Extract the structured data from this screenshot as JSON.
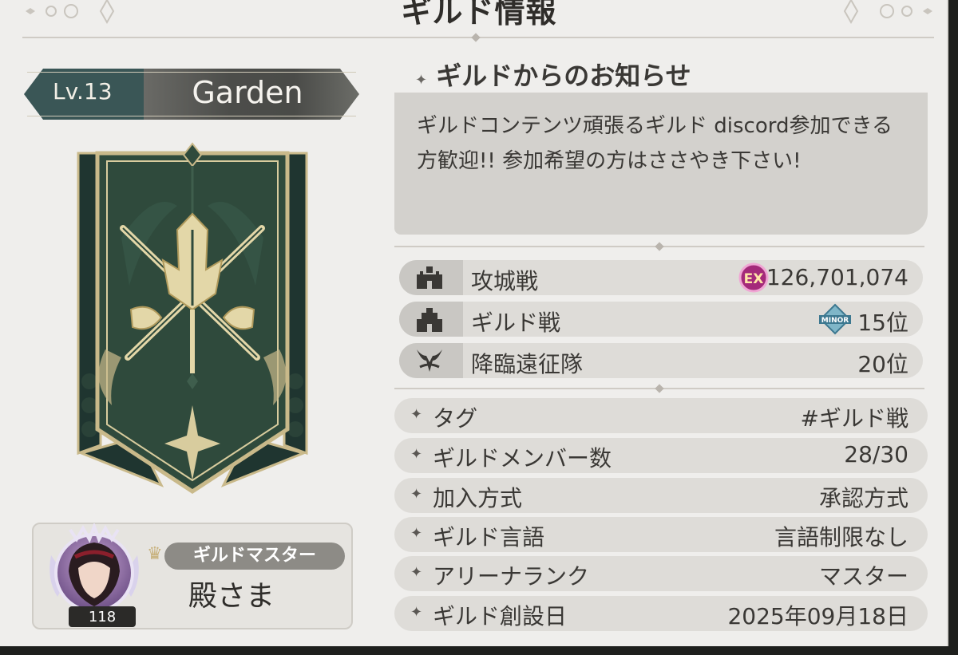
{
  "header": {
    "title": "ギルド情報"
  },
  "guild": {
    "level": "Lv.13",
    "name": "Garden"
  },
  "notice": {
    "heading": "ギルドからのお知らせ",
    "text": "ギルドコンテンツ頑張るギルド discord参加できる方歓迎!! 参加希望の方はささやき下さい!"
  },
  "stats": [
    {
      "label": "攻城戦",
      "value": "126,701,074",
      "icon": "castle-siege-icon",
      "badge": "EX",
      "badge_icon": "ex-rank-badge-icon"
    },
    {
      "label": "ギルド戦",
      "value": "15位",
      "icon": "fortress-icon",
      "badge": "MINOR",
      "badge_icon": "minor-rank-badge-icon"
    },
    {
      "label": "降臨遠征隊",
      "value": "20位",
      "icon": "demon-horns-icon"
    }
  ],
  "info": [
    {
      "label": "タグ",
      "value": "#ギルド戦"
    },
    {
      "label": "ギルドメンバー数",
      "value": "28/30"
    },
    {
      "label": "加入方式",
      "value": "承認方式"
    },
    {
      "label": "ギルド言語",
      "value": "言語制限なし"
    },
    {
      "label": "アリーナランク",
      "value": "マスター"
    },
    {
      "label": "ギルド創設日",
      "value": "2025年09月18日"
    }
  ],
  "master": {
    "label": "ギルドマスター",
    "name": "殿さま",
    "level": "118"
  },
  "colors": {
    "panel": "#efeeec",
    "banner_green": "#2f4a3c",
    "gold": "#c9b98a",
    "teal": "#3a5656"
  }
}
